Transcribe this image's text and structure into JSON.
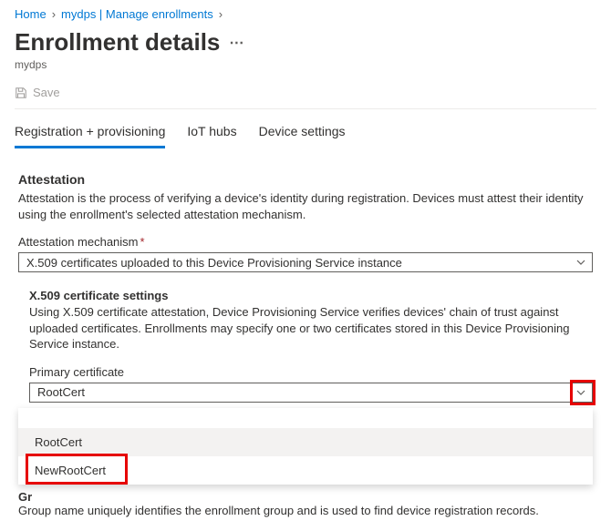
{
  "breadcrumb": {
    "home": "Home",
    "mydps": "mydps | Manage enrollments"
  },
  "header": {
    "title": "Enrollment details",
    "subtitle": "mydps"
  },
  "toolbar": {
    "save": "Save"
  },
  "tabs": {
    "reg": "Registration + provisioning",
    "iot": "IoT hubs",
    "device": "Device settings"
  },
  "attestation": {
    "heading": "Attestation",
    "desc": "Attestation is the process of verifying a device's identity during registration. Devices must attest their identity using the enrollment's selected attestation mechanism.",
    "mech_label": "Attestation mechanism",
    "mech_value": "X.509 certificates uploaded to this Device Provisioning Service instance"
  },
  "x509": {
    "heading": "X.509 certificate settings",
    "desc": "Using X.509 certificate attestation, Device Provisioning Service verifies devices' chain of trust against uploaded certificates. Enrollments may specify one or two certificates stored in this Device Provisioning Service instance.",
    "primary_label": "Primary certificate",
    "primary_value": "RootCert",
    "options": {
      "root": "RootCert",
      "newroot": "NewRootCert"
    }
  },
  "group": {
    "label_prefix": "Gr",
    "desc": "Group name uniquely identifies the enrollment group and is used to find device registration records."
  }
}
